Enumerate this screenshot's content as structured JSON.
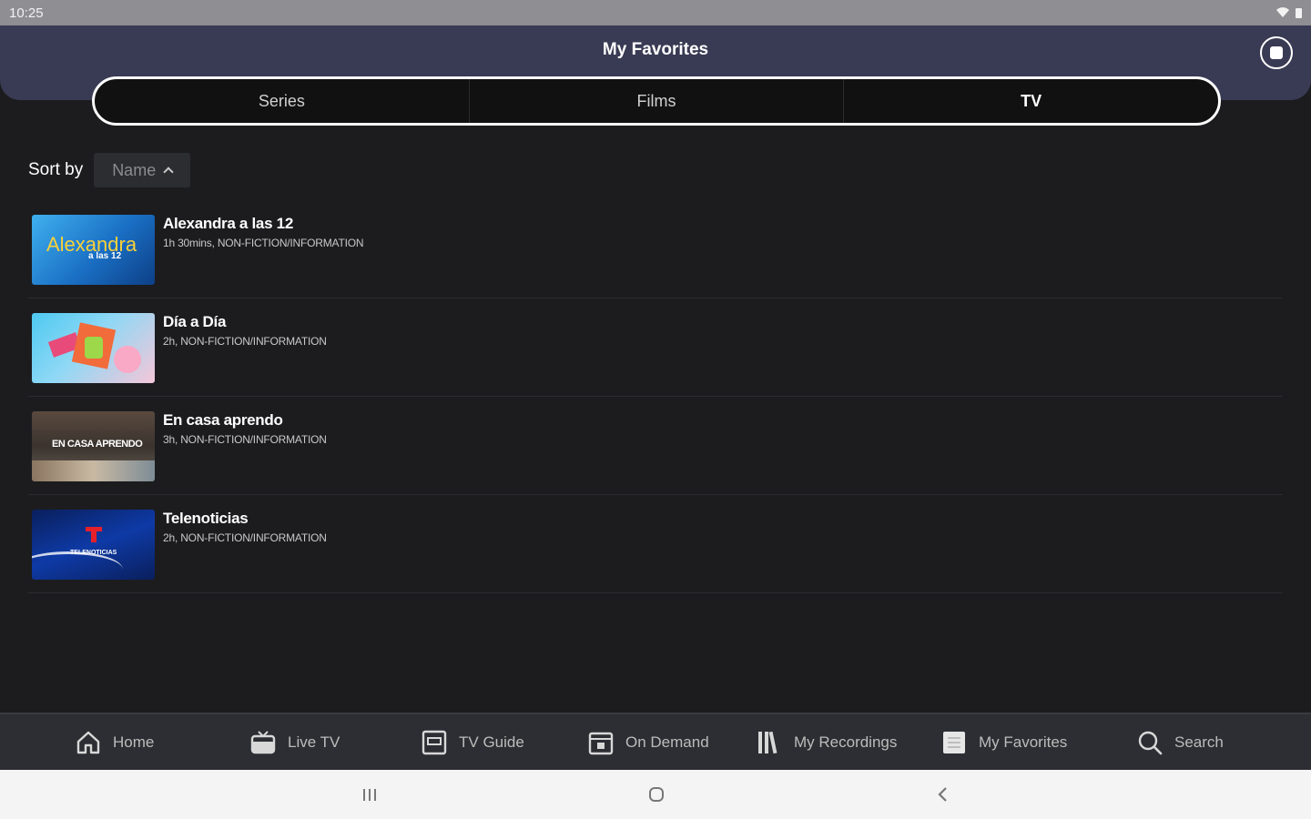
{
  "status_bar": {
    "time": "10:25"
  },
  "header": {
    "title": "My Favorites"
  },
  "tabs": [
    {
      "label": "Series",
      "active": false
    },
    {
      "label": "Films",
      "active": false
    },
    {
      "label": "TV",
      "active": true
    }
  ],
  "sort": {
    "label": "Sort by",
    "value": "Name"
  },
  "items": [
    {
      "title": "Alexandra a las 12",
      "meta": "1h 30mins, NON-FICTION/INFORMATION",
      "thumb_text": "Alexandra",
      "thumb_sub": "a las 12"
    },
    {
      "title": "Día a Día",
      "meta": "2h, NON-FICTION/INFORMATION"
    },
    {
      "title": "En casa aprendo",
      "meta": "3h, NON-FICTION/INFORMATION",
      "thumb_text": "EN CASA APRENDO"
    },
    {
      "title": "Telenoticias",
      "meta": "2h, NON-FICTION/INFORMATION",
      "thumb_text": "TELENOTICIAS"
    }
  ],
  "bottom_nav": [
    {
      "label": "Home",
      "icon": "home-icon"
    },
    {
      "label": "Live TV",
      "icon": "tv-icon"
    },
    {
      "label": "TV Guide",
      "icon": "guide-icon"
    },
    {
      "label": "On Demand",
      "icon": "on-demand-icon"
    },
    {
      "label": "My Recordings",
      "icon": "recordings-icon"
    },
    {
      "label": "My Favorites",
      "icon": "favorites-icon"
    },
    {
      "label": "Search",
      "icon": "search-icon"
    }
  ],
  "colors": {
    "header": "#393b54",
    "background": "#1c1c1f",
    "nav": "#2d2e33"
  }
}
